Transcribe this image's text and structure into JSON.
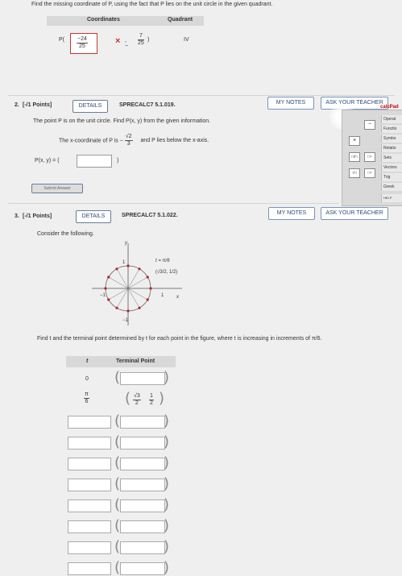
{
  "q1": {
    "instruction": "Find the missing coordinate of P, using the fact that P lies on the unit circle in the given quadrant.",
    "header_coordinates": "Coordinates",
    "header_quadrant": "Quadrant",
    "p_label": "P(",
    "x_num": "−24",
    "x_den": "25",
    "error_mark": "×",
    "y_sign": ", −",
    "y_num": "7",
    "y_den": "25",
    "close": ")",
    "quadrant": "IV"
  },
  "q2": {
    "number": "2.",
    "points": "[-/1 Points]",
    "details": "DETAILS",
    "code": "SPRECALC7 5.1.019.",
    "my_notes": "MY NOTES",
    "ask_teacher": "ASK YOUR TEACHER",
    "calcpad": "calcPad",
    "statement": "The point P is on the unit circle. Find P(x, y) from the given information.",
    "given_prefix": "The x-coordinate of P is  −",
    "given_num": "√2",
    "given_den": "3",
    "given_suffix": "and P lies below the x-axis.",
    "answer_label": "P(x, y) = (",
    "answer_close": ")",
    "submit": "Submit Answer"
  },
  "palette": {
    "minus": "−",
    "times": "×",
    "frac": "□/□",
    "sqrt": "√□",
    "power": "□ⁿ",
    "items": [
      "Operat",
      "Functio",
      "Symbo",
      "Relatio",
      "Sets",
      "Vectors",
      "Trig",
      "Greek"
    ],
    "help": "HELP"
  },
  "q3": {
    "number": "3.",
    "points": "[-/1 Points]",
    "details": "DETAILS",
    "code": "SPRECALC7 5.1.022.",
    "my_notes": "MY NOTES",
    "ask_teacher": "ASK YOUR TEACHER",
    "consider": "Consider the following.",
    "axis_y": "y",
    "axis_x": "x",
    "tick_1_top": "1",
    "tick_neg1_left": "−1",
    "tick_1_right": "1",
    "tick_neg1_bottom": "−1",
    "t_label": "t = π/6",
    "point_label": "(√3/2, 1/2)",
    "instruction": "Find t and the terminal point determined by t for each point in the figure, where t is increasing in increments of π/6.",
    "col_t": "t",
    "col_terminal": "Terminal Point",
    "row0_t": "0",
    "row1_t_num": "π",
    "row1_t_den": "6",
    "row1_point_x_num": "√3",
    "row1_point_x_den": "2",
    "row1_point_y_num": "1",
    "row1_point_y_den": "2"
  }
}
